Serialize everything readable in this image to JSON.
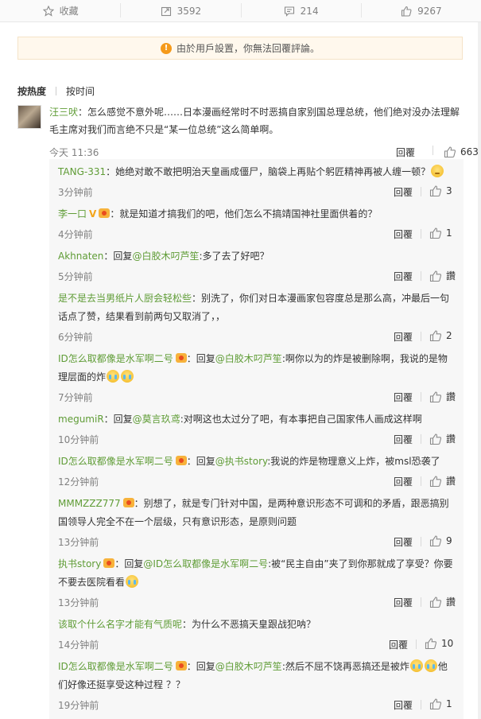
{
  "action_bar": {
    "collect_label": "收藏",
    "repost_count": "3592",
    "comment_count": "214",
    "like_count": "9267"
  },
  "notice": {
    "text": "由於用戶設置，你無法回覆評論。"
  },
  "sort": {
    "by_hot": "按热度",
    "by_time": "按时间"
  },
  "main_comment": {
    "user": "汪三吠",
    "text": "：怎么感觉不意外呢……日本漫画经常时不时恶搞自家别国总理总统，他们绝对没办法理解毛主席对我们而言绝不只是“某一位总统”这么简单啊。",
    "time": "今天 11:36",
    "reply_label": "回覆",
    "likes": "663"
  },
  "replies": [
    {
      "user": "TANG-331",
      "text": "：她绝对敢不敢把明治天皇画成僵尸，脑袋上再贴个躬匠精神再被人缠一顿？",
      "emoji": "smirk",
      "time": "3分钟前",
      "reply_label": "回覆",
      "likes": "3"
    },
    {
      "user": "李一口",
      "vip": "V",
      "badge": true,
      "text": "：就是知道才搞我们的吧，他们怎么不搞靖国神社里面供着的？",
      "time": "4分钟前",
      "reply_label": "回覆",
      "likes": "1"
    },
    {
      "user": "Akhnaten",
      "prefix": "：回复",
      "mention": "@白胶木叼芦笙",
      "text": ":多了去了好吧？",
      "time": "5分钟前",
      "reply_label": "回覆",
      "likes": "讚"
    },
    {
      "user": "是不是去当男纸片人厨会轻松些",
      "text": "：别洗了，你们对日本漫画家包容度总是那么高，冲最后一句话点了赞，结果看到前两句又取消了，，",
      "time": "6分钟前",
      "reply_label": "回覆",
      "likes": "2"
    },
    {
      "user": "ID怎么取都像是水军啊二号",
      "badge": true,
      "prefix": "：回复",
      "mention": "@白胶木叼芦笙",
      "text": ":啊你以为的炸是被删除啊，我说的是物理层面的炸",
      "emoji": "cry2",
      "time": "7分钟前",
      "reply_label": "回覆",
      "likes": "讚"
    },
    {
      "user": "megumiR",
      "prefix": "：回复",
      "mention": "@莫言玖鸢",
      "text": ":对啊这也太过分了吧，有本事把自己国家伟人画成这样啊",
      "time": "10分钟前",
      "reply_label": "回覆",
      "likes": "讚"
    },
    {
      "user": "ID怎么取都像是水军啊二号",
      "badge": true,
      "prefix": "：回复",
      "mention": "@执书story",
      "text": ":我说的炸是物理意义上炸，被msl恐袭了",
      "time": "12分钟前",
      "reply_label": "回覆",
      "likes": "讚"
    },
    {
      "user": "MMMZZZ777",
      "badge": true,
      "text": "：别想了，就是专门针对中国，是两种意识形态不可调和的矛盾，跟恶搞别国领导人完全不在一个层级，只有意识形态，是原则问题",
      "time": "13分钟前",
      "reply_label": "回覆",
      "likes": "9"
    },
    {
      "user": "执书story",
      "badge": true,
      "prefix": "：回复",
      "mention": "@ID怎么取都像是水军啊二号",
      "text": ":被“民主自由”夹了到你那就成了享受？你要不要去医院看看",
      "emoji": "cry1",
      "time": "13分钟前",
      "reply_label": "回覆",
      "likes": "讚"
    },
    {
      "user": "该取个什么名字才能有气质呢",
      "text": "：为什么不恶搞天皇跟战犯呐？",
      "time": "14分钟前",
      "reply_label": "回覆",
      "likes": "10"
    },
    {
      "user": "ID怎么取都像是水军啊二号",
      "badge": true,
      "prefix": "：回复",
      "mention": "@白胶木叼芦笙",
      "text": ":然后不屈不饶再恶搞还是被炸",
      "emoji": "cry2",
      "text_after": "他们好像还挺享受这种过程 ？？",
      "time": "19分钟前",
      "reply_label": "回覆",
      "likes": "1"
    }
  ]
}
